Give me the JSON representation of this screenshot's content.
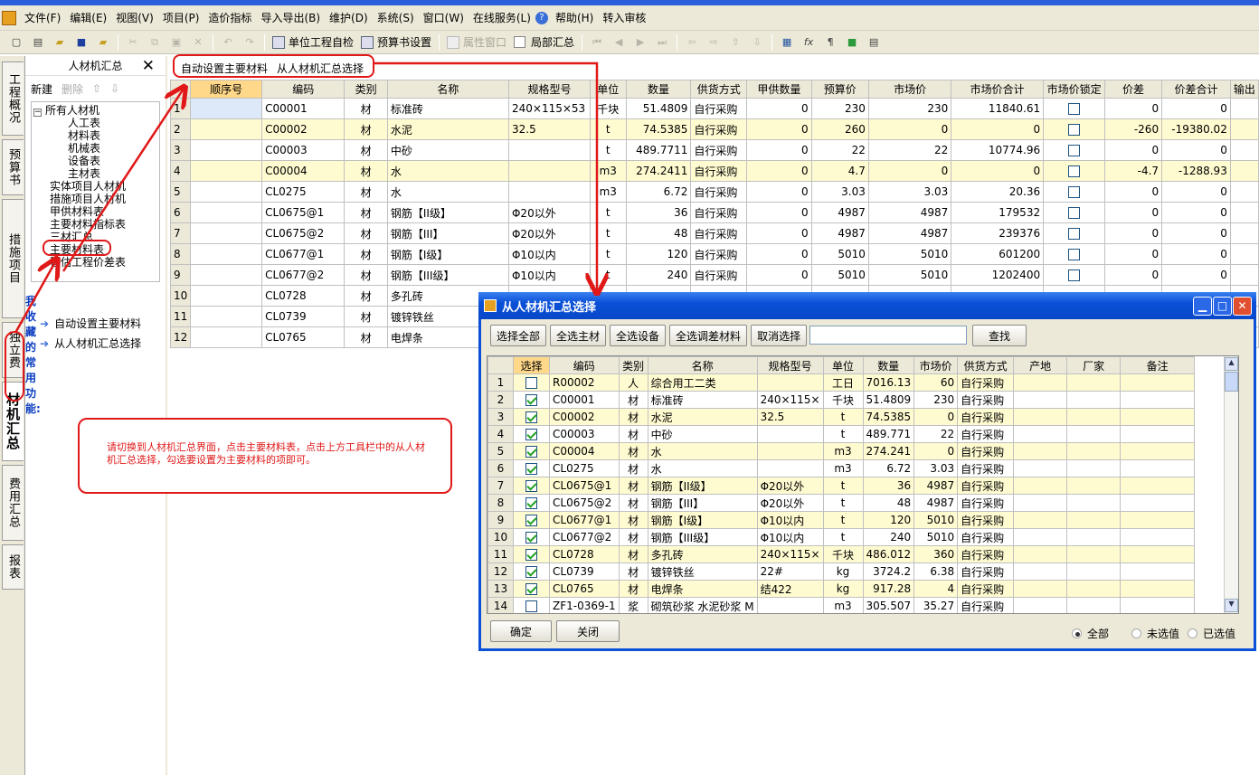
{
  "menu": [
    "文件(F)",
    "编辑(E)",
    "视图(V)",
    "项目(P)",
    "造价指标",
    "导入导出(B)",
    "维护(D)",
    "系统(S)",
    "窗口(W)",
    "在线服务(L)",
    "帮助(H)",
    "转入审核"
  ],
  "toolbar": {
    "check": "单位工程自检",
    "budget_setting": "预算书设置",
    "prop_window": "属性窗口",
    "local_summary": "局部汇总"
  },
  "left_tabs": [
    "工程概况",
    "预算书",
    "措施项目",
    "独立费",
    "材机汇总",
    "费用汇总",
    "报表"
  ],
  "nav": {
    "title": "人材机汇总",
    "new": "新建",
    "delete": "删除",
    "tree": [
      "所有人材机",
      "人工表",
      "材料表",
      "机械表",
      "设备表",
      "主材表",
      "实体项目人材机",
      "措施项目人材机",
      "甲供材料表",
      "主要材料指标表",
      "三材汇总",
      "主要材料表",
      "暂估工程价差表"
    ],
    "fav_title": "我收藏的常用功能:",
    "fav": [
      "自动设置主要材料",
      "从人材机汇总选择"
    ]
  },
  "grid_toolbar": [
    "自动设置主要材料",
    "从人材机汇总选择"
  ],
  "main_headers": [
    "",
    "顺序号",
    "编码",
    "类别",
    "名称",
    "规格型号",
    "单位",
    "数量",
    "供货方式",
    "甲供数量",
    "预算价",
    "市场价",
    "市场价合计",
    "市场价锁定",
    "价差",
    "价差合计",
    "输出"
  ],
  "main_rows": [
    [
      "1",
      "",
      "C00001",
      "材",
      "标准砖",
      "240×115×53",
      "千块",
      "51.4809",
      "自行采购",
      "0",
      "230",
      "230",
      "11840.61",
      "",
      "0",
      "0"
    ],
    [
      "2",
      "",
      "C00002",
      "材",
      "水泥",
      "32.5",
      "t",
      "74.5385",
      "自行采购",
      "0",
      "260",
      "0",
      "0",
      "",
      "-260",
      "-19380.02"
    ],
    [
      "3",
      "",
      "C00003",
      "材",
      "中砂",
      "",
      "t",
      "489.7711",
      "自行采购",
      "0",
      "22",
      "22",
      "10774.96",
      "",
      "0",
      "0"
    ],
    [
      "4",
      "",
      "C00004",
      "材",
      "水",
      "",
      "m3",
      "274.2411",
      "自行采购",
      "0",
      "4.7",
      "0",
      "0",
      "",
      "-4.7",
      "-1288.93"
    ],
    [
      "5",
      "",
      "CL0275",
      "材",
      "水",
      "",
      "m3",
      "6.72",
      "自行采购",
      "0",
      "3.03",
      "3.03",
      "20.36",
      "",
      "0",
      "0"
    ],
    [
      "6",
      "",
      "CL0675@1",
      "材",
      "钢筋【II级】",
      "Φ20以外",
      "t",
      "36",
      "自行采购",
      "0",
      "4987",
      "4987",
      "179532",
      "",
      "0",
      "0"
    ],
    [
      "7",
      "",
      "CL0675@2",
      "材",
      "钢筋【III】",
      "Φ20以外",
      "t",
      "48",
      "自行采购",
      "0",
      "4987",
      "4987",
      "239376",
      "",
      "0",
      "0"
    ],
    [
      "8",
      "",
      "CL0677@1",
      "材",
      "钢筋【I级】",
      "Φ10以内",
      "t",
      "120",
      "自行采购",
      "0",
      "5010",
      "5010",
      "601200",
      "",
      "0",
      "0"
    ],
    [
      "9",
      "",
      "CL0677@2",
      "材",
      "钢筋【III级】",
      "Φ10以内",
      "t",
      "240",
      "自行采购",
      "0",
      "5010",
      "5010",
      "1202400",
      "",
      "0",
      "0"
    ],
    [
      "10",
      "",
      "CL0728",
      "材",
      "多孔砖",
      "",
      "",
      "",
      "",
      "",
      "",
      "",
      "",
      "",
      "",
      ""
    ],
    [
      "11",
      "",
      "CL0739",
      "材",
      "镀锌铁丝",
      "",
      "",
      "",
      "",
      "",
      "",
      "",
      "",
      "",
      "",
      ""
    ],
    [
      "12",
      "",
      "CL0765",
      "材",
      "电焊条",
      "",
      "",
      "",
      "",
      "",
      "",
      "",
      "",
      "",
      "",
      ""
    ]
  ],
  "dialog": {
    "title": "从人材机汇总选择",
    "buttons": [
      "选择全部",
      "全选主材",
      "全选设备",
      "全选调差材料",
      "取消选择"
    ],
    "find": "查找",
    "find_value": "",
    "ok": "确定",
    "close": "关闭",
    "radios": [
      "全部",
      "未选值",
      "已选值"
    ],
    "headers": [
      "",
      "选择",
      "编码",
      "类别",
      "名称",
      "规格型号",
      "单位",
      "数量",
      "市场价",
      "供货方式",
      "产地",
      "厂家",
      "备注"
    ],
    "rows": [
      [
        "1",
        false,
        "R00002",
        "人",
        "综合用工二类",
        "",
        "工日",
        "7016.13",
        "60",
        "自行采购"
      ],
      [
        "2",
        true,
        "C00001",
        "材",
        "标准砖",
        "240×115×",
        "千块",
        "51.4809",
        "230",
        "自行采购"
      ],
      [
        "3",
        true,
        "C00002",
        "材",
        "水泥",
        "32.5",
        "t",
        "74.5385",
        "0",
        "自行采购"
      ],
      [
        "4",
        true,
        "C00003",
        "材",
        "中砂",
        "",
        "t",
        "489.771",
        "22",
        "自行采购"
      ],
      [
        "5",
        true,
        "C00004",
        "材",
        "水",
        "",
        "m3",
        "274.241",
        "0",
        "自行采购"
      ],
      [
        "6",
        true,
        "CL0275",
        "材",
        "水",
        "",
        "m3",
        "6.72",
        "3.03",
        "自行采购"
      ],
      [
        "7",
        true,
        "CL0675@1",
        "材",
        "钢筋【II级】",
        "Φ20以外",
        "t",
        "36",
        "4987",
        "自行采购"
      ],
      [
        "8",
        true,
        "CL0675@2",
        "材",
        "钢筋【III】",
        "Φ20以外",
        "t",
        "48",
        "4987",
        "自行采购"
      ],
      [
        "9",
        true,
        "CL0677@1",
        "材",
        "钢筋【I级】",
        "Φ10以内",
        "t",
        "120",
        "5010",
        "自行采购"
      ],
      [
        "10",
        true,
        "CL0677@2",
        "材",
        "钢筋【III级】",
        "Φ10以内",
        "t",
        "240",
        "5010",
        "自行采购"
      ],
      [
        "11",
        true,
        "CL0728",
        "材",
        "多孔砖",
        "240×115×",
        "千块",
        "486.012",
        "360",
        "自行采购"
      ],
      [
        "12",
        true,
        "CL0739",
        "材",
        "镀锌铁丝",
        "22#",
        "kg",
        "3724.2",
        "6.38",
        "自行采购"
      ],
      [
        "13",
        true,
        "CL0765",
        "材",
        "电焊条",
        "结422",
        "kg",
        "917.28",
        "4",
        "自行采购"
      ],
      [
        "14",
        false,
        "ZF1-0369-1",
        "浆",
        "砌筑砂浆 水泥砂浆 M",
        "",
        "m3",
        "305.507",
        "35.27",
        "自行采购"
      ]
    ]
  },
  "note": "请切换到人材机汇总界面，点击主要材料表，点击上方工具栏中的从人材机汇总选择，勾选要设置为主要材料的项即可。"
}
